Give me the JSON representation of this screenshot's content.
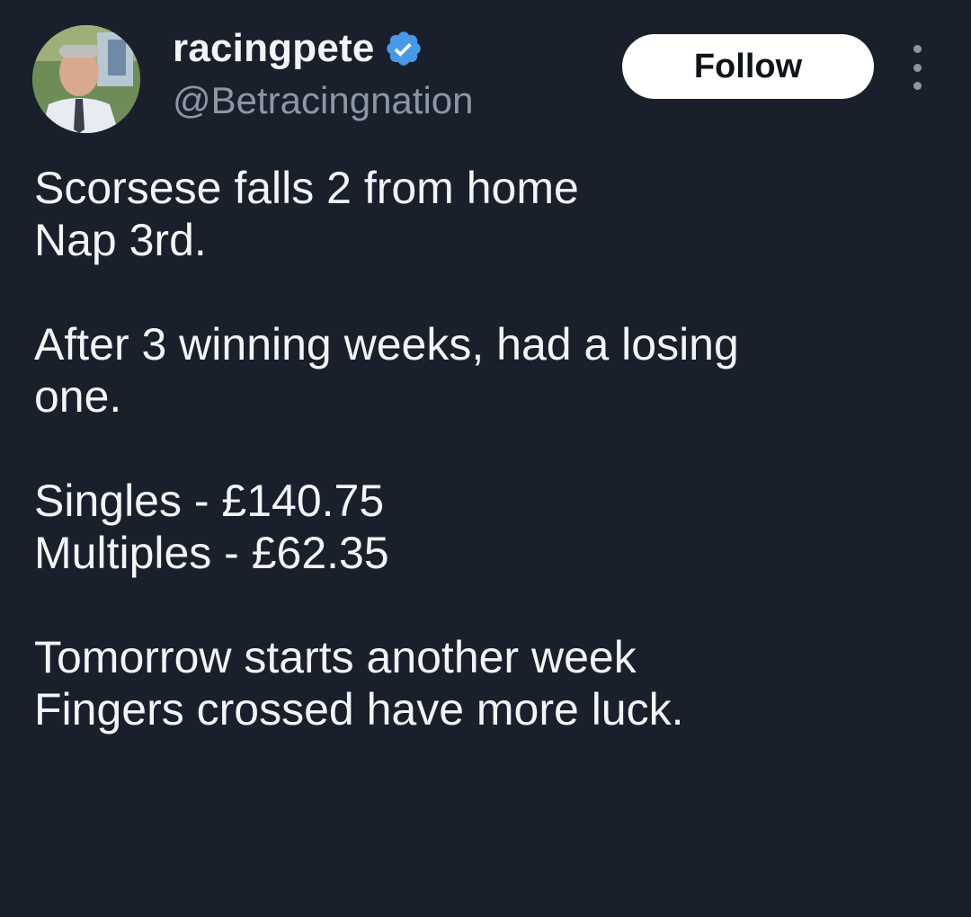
{
  "profile": {
    "display_name": "racingpete",
    "handle": "@Betracingnation",
    "verified": true,
    "verified_icon": "verified-badge-icon",
    "accent_color": "#4a99e9"
  },
  "actions": {
    "follow_label": "Follow",
    "more_icon": "more-vertical-icon"
  },
  "tweet": {
    "lines": [
      "Scorsese falls 2 from home",
      "Nap 3rd.",
      "",
      "After 3 winning weeks, had a losing",
      "one.",
      "",
      "Singles - £140.75",
      "Multiples - £62.35",
      "",
      "Tomorrow starts another week",
      "Fingers crossed have more luck."
    ]
  },
  "theme": {
    "background": "#1a202b",
    "text": "#f2f4f6",
    "secondary_text": "#8b97a4"
  }
}
